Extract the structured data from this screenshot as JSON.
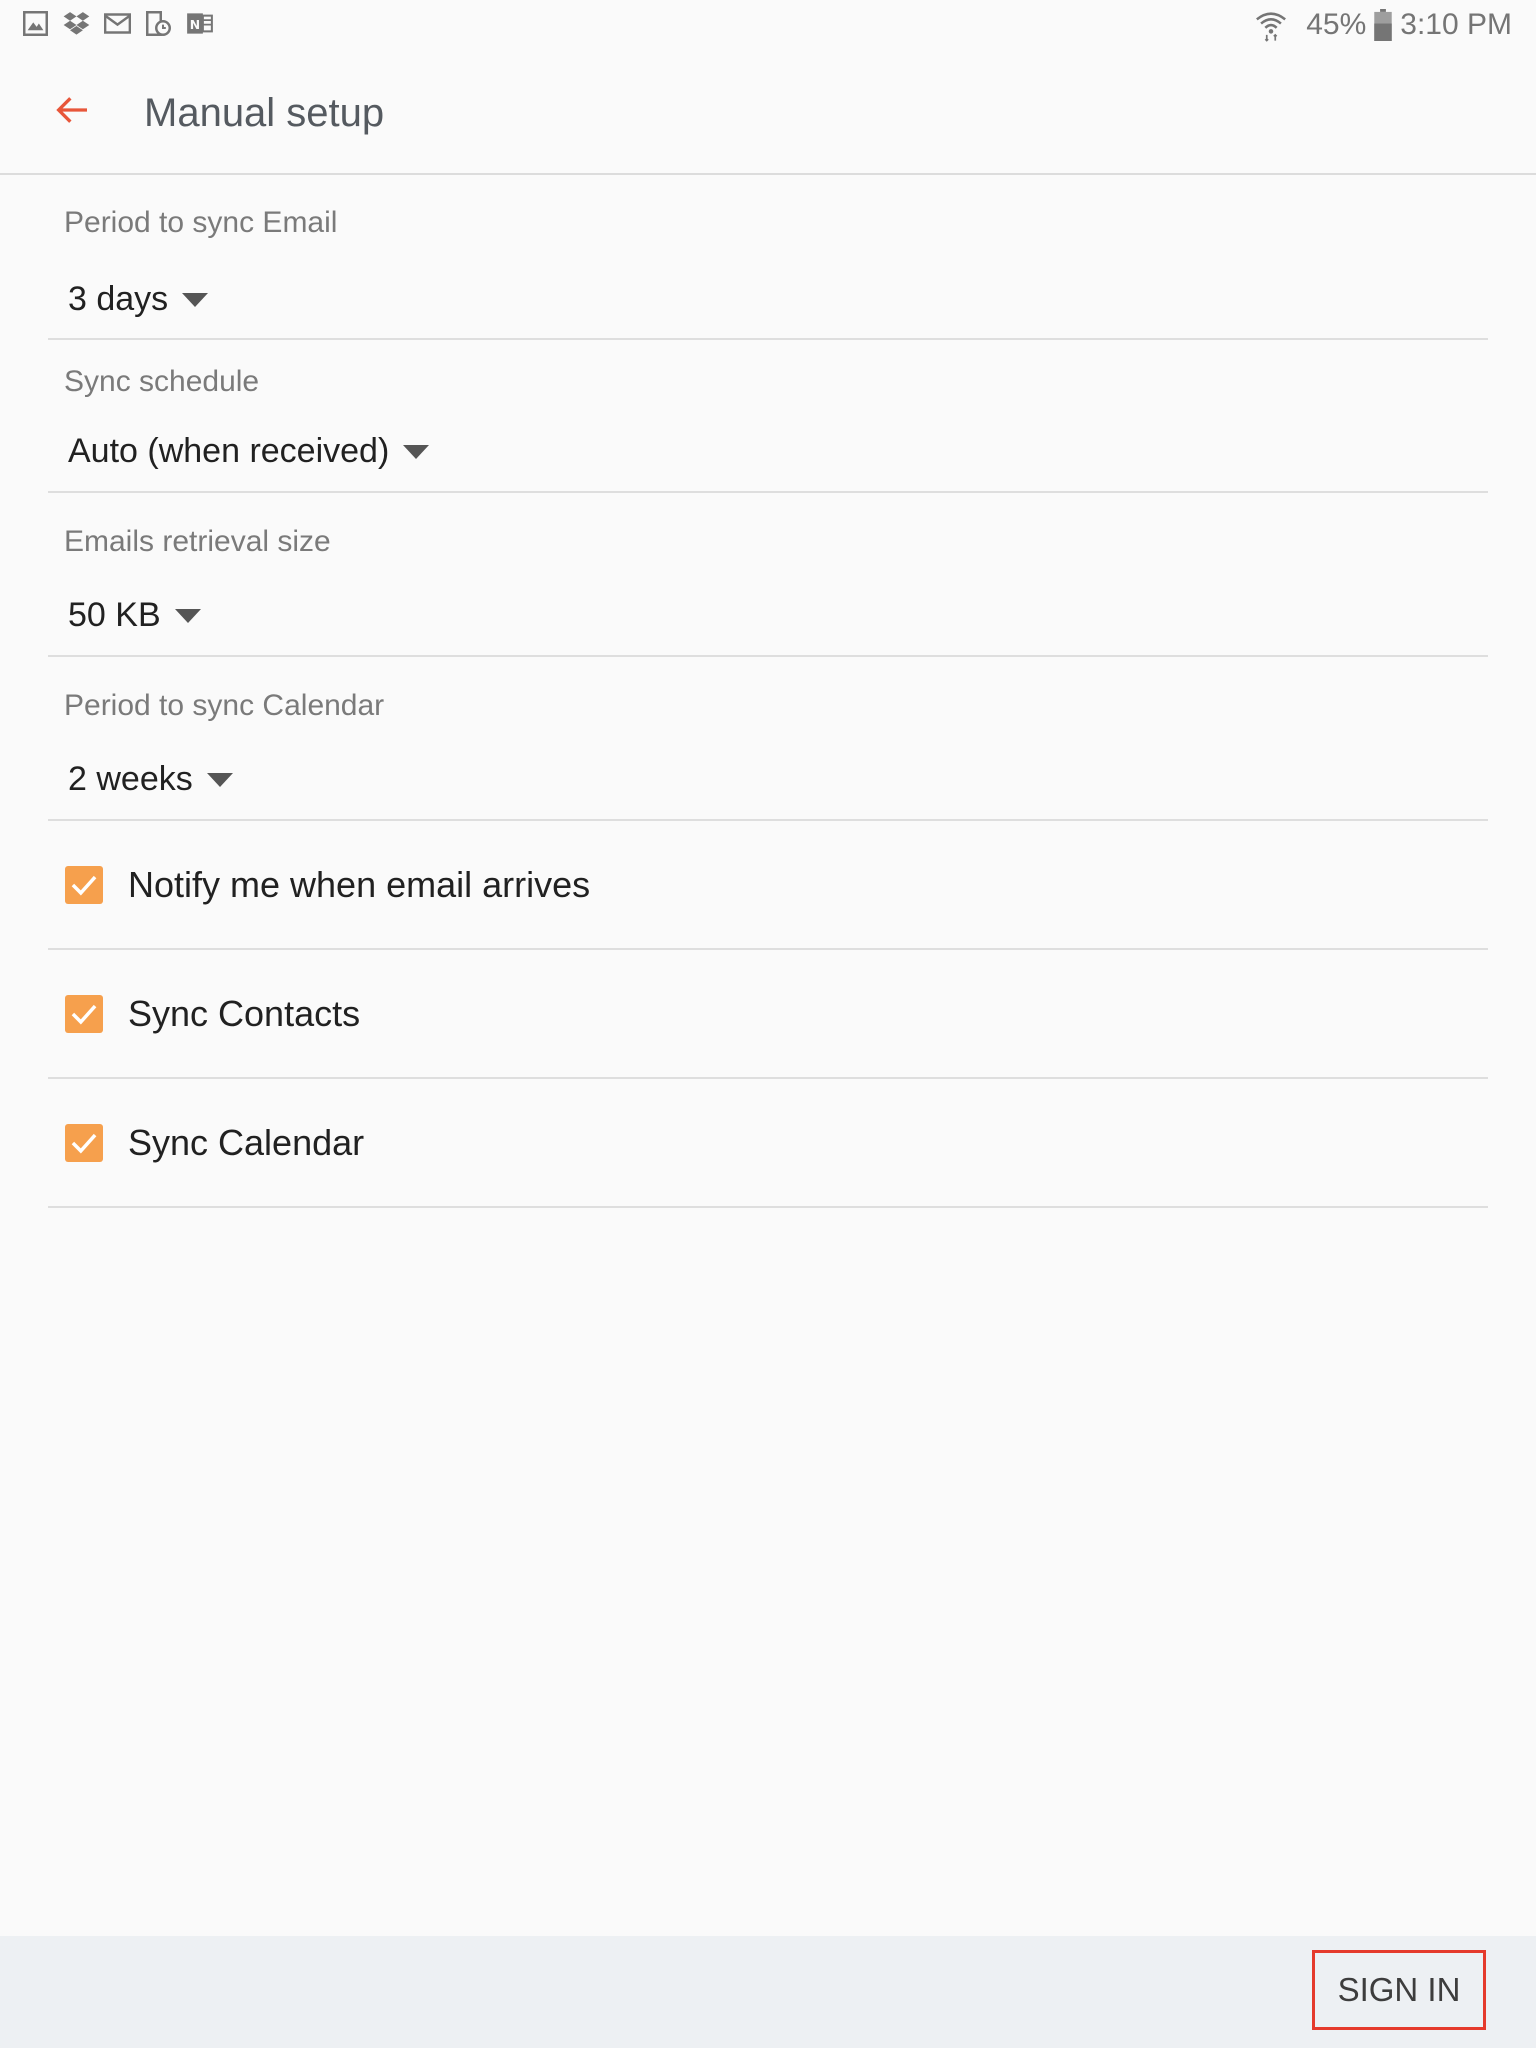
{
  "status_bar": {
    "battery_percent": "45%",
    "time": "3:10 PM",
    "icons_left": [
      "gallery-icon",
      "dropbox-icon",
      "gmail-icon",
      "device-clock-icon",
      "onenote-icon"
    ]
  },
  "app_bar": {
    "title": "Manual setup",
    "back_icon": "arrow-left-icon"
  },
  "settings": {
    "sync_email": {
      "label": "Period to sync Email",
      "value": "3 days"
    },
    "sync_schedule": {
      "label": "Sync schedule",
      "value": "Auto (when received)"
    },
    "retrieval_size": {
      "label": "Emails retrieval size",
      "value": "50 KB"
    },
    "sync_calendar_period": {
      "label": "Period to sync Calendar",
      "value": "2 weeks"
    },
    "checkboxes": [
      {
        "label": "Notify me when email arrives",
        "checked": true
      },
      {
        "label": "Sync Contacts",
        "checked": true
      },
      {
        "label": "Sync Calendar",
        "checked": true
      }
    ]
  },
  "bottom_bar": {
    "sign_in_label": "SIGN IN"
  },
  "colors": {
    "accent": "#e8563a",
    "checkbox": "#f6a04d",
    "highlight_border": "#e53a2c"
  }
}
